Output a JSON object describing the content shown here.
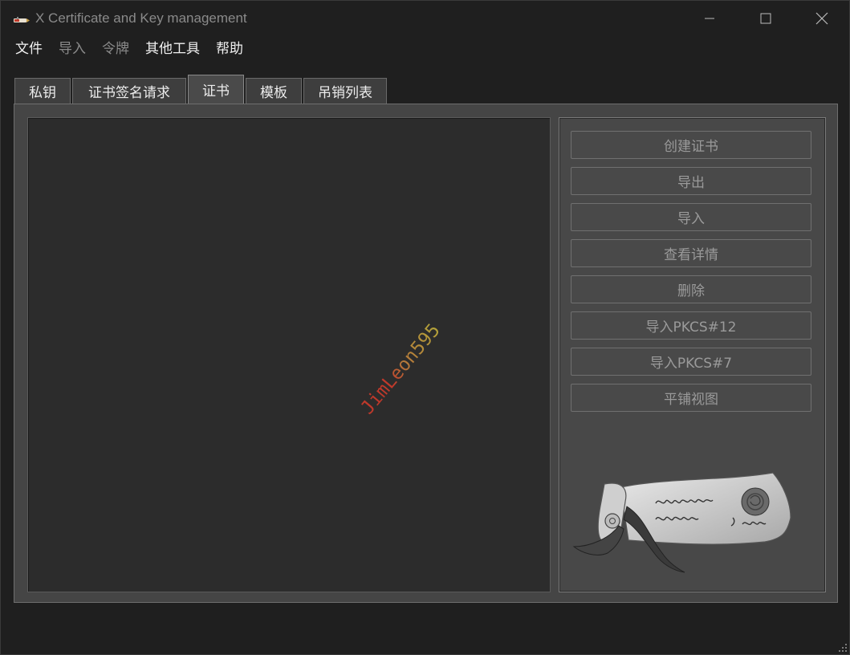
{
  "window": {
    "title": "X Certificate and Key management"
  },
  "menu": [
    {
      "label": "文件",
      "enabled": true
    },
    {
      "label": "导入",
      "enabled": false
    },
    {
      "label": "令牌",
      "enabled": false
    },
    {
      "label": "其他工具",
      "enabled": true
    },
    {
      "label": "帮助",
      "enabled": true
    }
  ],
  "tabs": [
    {
      "label": "私钥"
    },
    {
      "label": "证书签名请求"
    },
    {
      "label": "证书",
      "active": true
    },
    {
      "label": "模板"
    },
    {
      "label": "吊销列表"
    }
  ],
  "watermark": "JimLeon595",
  "actions": [
    {
      "label": "创建证书"
    },
    {
      "label": "导出"
    },
    {
      "label": "导入"
    },
    {
      "label": "查看详情"
    },
    {
      "label": "删除"
    },
    {
      "label": "导入PKCS#12"
    },
    {
      "label": "导入PKCS#7"
    },
    {
      "label": "平铺视图"
    }
  ],
  "colors": {
    "window_bg": "#1f1f1f",
    "panel_bg": "#454545",
    "list_bg": "#2c2c2c",
    "disabled_text": "#9a9a9a"
  }
}
